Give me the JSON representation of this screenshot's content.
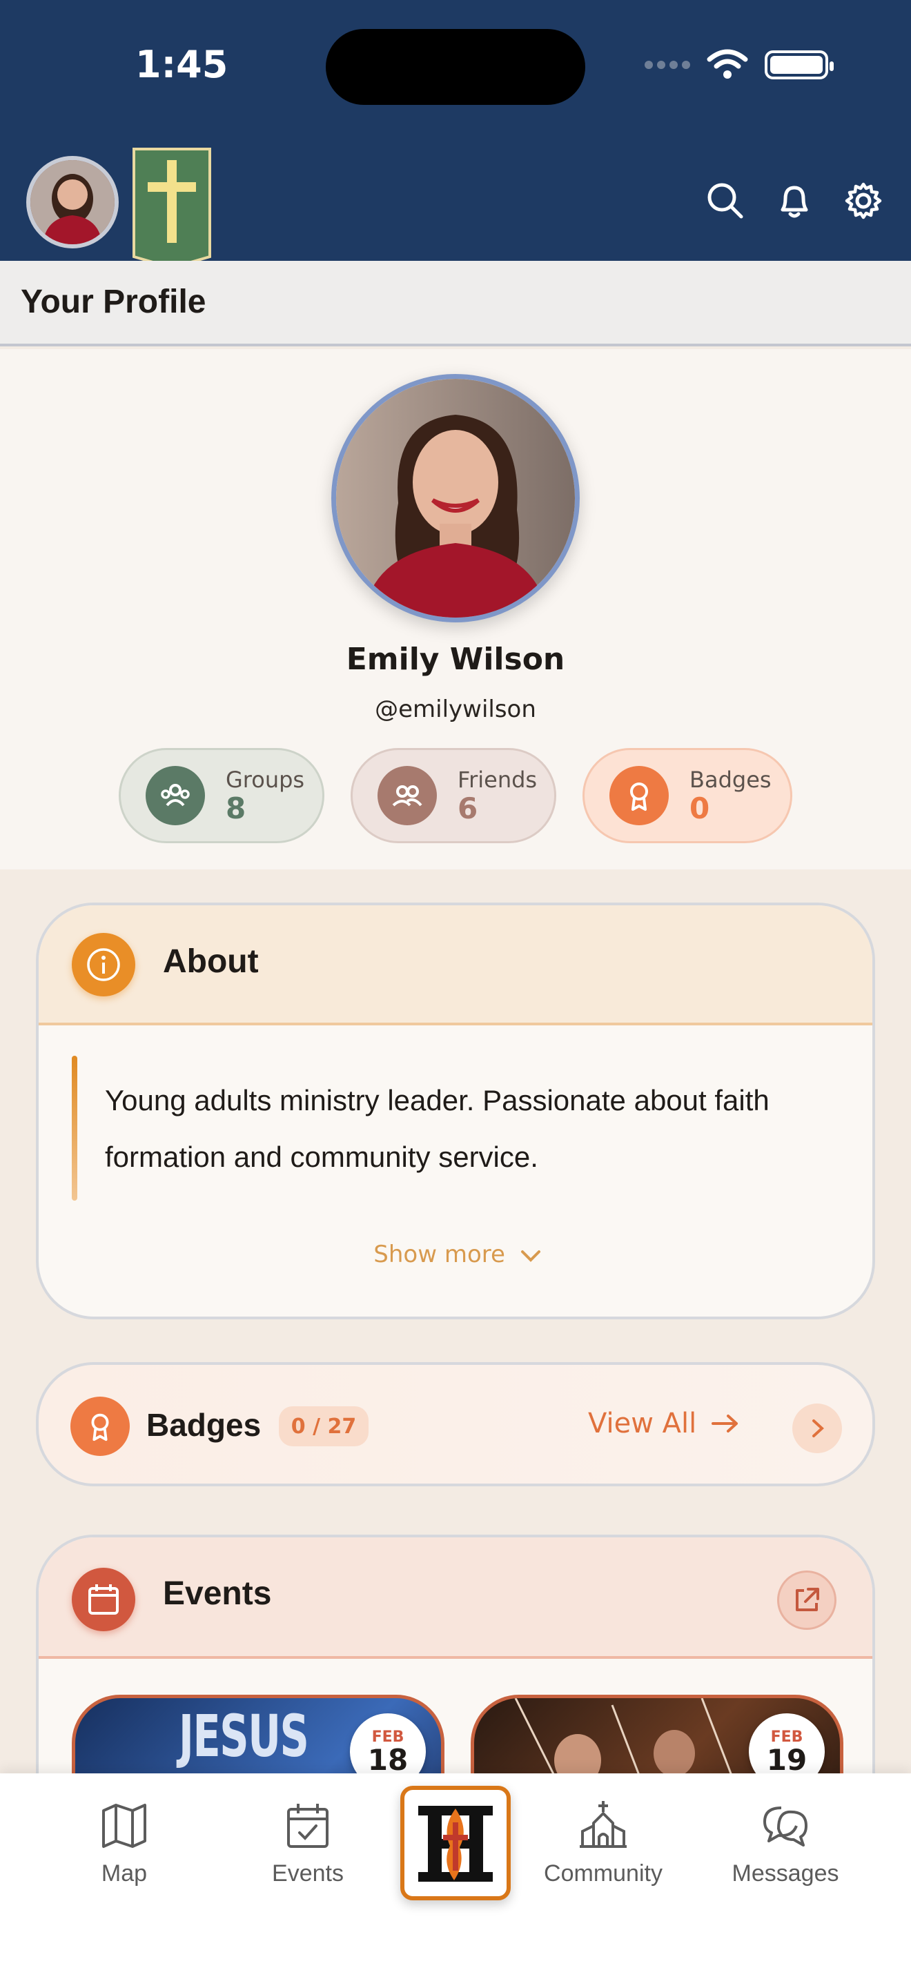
{
  "status_bar": {
    "time": "1:45"
  },
  "header": {
    "section_title": "Your Profile"
  },
  "profile": {
    "name": "Emily Wilson",
    "handle": "@emilywilson",
    "stats": [
      {
        "label": "Groups",
        "value": "8",
        "color": "#5b7a66"
      },
      {
        "label": "Friends",
        "value": "6",
        "color": "#a77a6e"
      },
      {
        "label": "Badges",
        "value": "0",
        "color": "#ee7a43"
      }
    ]
  },
  "about": {
    "title": "About",
    "bio": "Young adults ministry leader. Passionate about faith formation and community service.",
    "show_more": "Show more"
  },
  "badges": {
    "title": "Badges",
    "count": "0 / 27",
    "view_all": "View All"
  },
  "events": {
    "title": "Events",
    "items": [
      {
        "image_text": "JESUS",
        "month": "FEB",
        "day": "18"
      },
      {
        "image_text": "",
        "month": "FEB",
        "day": "19"
      }
    ]
  },
  "nav": {
    "items": [
      {
        "label": "Map",
        "icon": "map-icon"
      },
      {
        "label": "Events",
        "icon": "calendar-check-icon"
      },
      {
        "label": "Community",
        "icon": "church-icon"
      },
      {
        "label": "Messages",
        "icon": "chat-bubbles-icon"
      }
    ]
  },
  "colors": {
    "header_bg": "#1e3a63",
    "accent_orange": "#e98e27",
    "accent_coral": "#ee7a43"
  }
}
